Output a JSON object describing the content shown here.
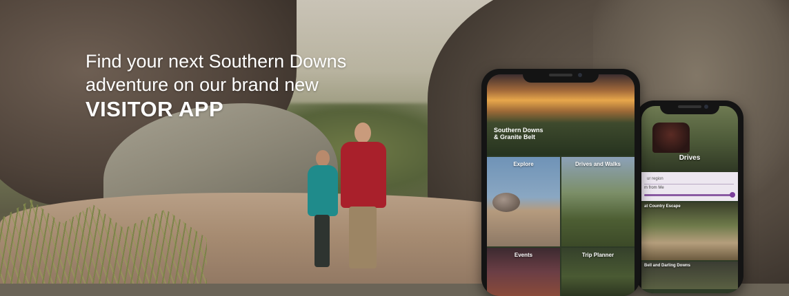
{
  "headline": {
    "line1": "Find your next Southern Downs",
    "line2": "adventure on our brand new",
    "brand": "VISITOR APP"
  },
  "phone_main": {
    "logo_line1": "Southern Downs",
    "logo_line2": "& Granite Belt",
    "tiles": [
      {
        "label": "Explore"
      },
      {
        "label": "Drives and Walks"
      },
      {
        "label": "Events"
      },
      {
        "label": "Trip Planner"
      }
    ]
  },
  "phone_secondary": {
    "title": "Drives",
    "search_field": "ur region",
    "slider_label": "m from Me",
    "cards": [
      {
        "title": "at Country Escape"
      },
      {
        "title": "Bell and Darling Downs"
      }
    ]
  }
}
